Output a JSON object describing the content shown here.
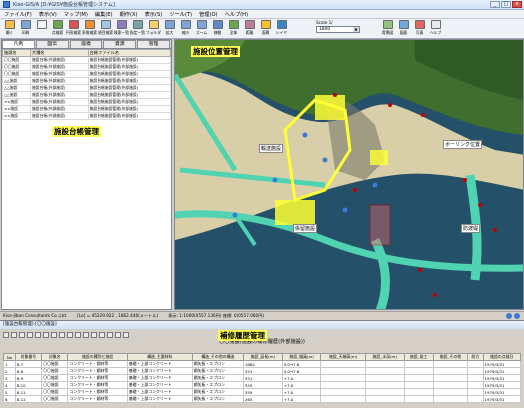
{
  "window": {
    "title": "Kiso-GIS/A [D:¥GIS¥施設台帳管理システム]"
  },
  "menu": [
    "ファイル(F)",
    "表示(V)",
    "マップ(M)",
    "編集(E)",
    "期作(X)",
    "表示(S)",
    "ツール(T)",
    "管理(O)",
    "ヘルプ(H)"
  ],
  "toolbar": [
    {
      "label": "開く",
      "icon": "open-icon",
      "color": "#f2c04a"
    },
    {
      "label": "印刷",
      "icon": "print-icon",
      "color": "#7aa6d9"
    },
    {
      "label": "",
      "icon": "pointer-icon",
      "color": "#f4f4f4"
    },
    {
      "label": "点検索",
      "icon": "point-search-icon",
      "color": "#6aa84f"
    },
    {
      "label": "円形検索",
      "icon": "circle-search-icon",
      "color": "#d9534f"
    },
    {
      "label": "多角検索",
      "icon": "polygon-search-icon",
      "color": "#e69138"
    },
    {
      "label": "項目検索",
      "icon": "item-search-icon",
      "color": "#9fc5e8"
    },
    {
      "label": "検索一覧",
      "icon": "result-list-icon",
      "color": "#8e7cc3"
    },
    {
      "label": "指定一覧",
      "icon": "selected-list-icon",
      "color": "#76a5af"
    },
    {
      "label": "フォルダ",
      "icon": "folder-icon",
      "color": "#f6d06a"
    },
    {
      "label": "拡大",
      "icon": "zoom-in-icon",
      "color": "#7aa6d9"
    },
    {
      "label": "縮小",
      "icon": "zoom-out-icon",
      "color": "#7aa6d9"
    },
    {
      "label": "ズーム",
      "icon": "zoom-icon",
      "color": "#7aa6d9"
    },
    {
      "label": "移動",
      "icon": "pan-icon",
      "color": "#5b8ac6"
    },
    {
      "label": "全体",
      "icon": "full-extent-icon",
      "color": "#6aa84f"
    },
    {
      "label": "距離",
      "icon": "measure-icon",
      "color": "#c27ba0"
    },
    {
      "label": "面積",
      "icon": "area-icon",
      "color": "#f1c232"
    },
    {
      "label": "レイヤ",
      "icon": "layer-icon",
      "color": "#3d85c6"
    }
  ],
  "toolbar_right": [
    {
      "label": "背景図",
      "icon": "background-map-icon",
      "color": "#93c47d"
    },
    {
      "label": "図面",
      "icon": "drawing-icon",
      "color": "#6fa8dc"
    },
    {
      "label": "写真",
      "icon": "photo-icon",
      "color": "#e06666"
    },
    {
      "label": "ヘルプ",
      "icon": "help-icon",
      "color": "#e8e8e8"
    }
  ],
  "scale": {
    "label": "Scale 1/",
    "value": "1800"
  },
  "left_tabs": [
    "凡例",
    "図伝",
    "座標",
    "資源",
    "管理"
  ],
  "left_list": {
    "headers": [
      "施設名",
      "大種名",
      "台帳ファイル名"
    ],
    "rows": [
      [
        "〇〇施設",
        "施設台帳(外部施設)",
        "施設台帳施設管理(外部施設)"
      ],
      [
        "〇〇施設",
        "施設台帳(外部施設)",
        "施設台帳施設管理(外部施設)"
      ],
      [
        "〇〇施設",
        "施設台帳(外部施設)",
        "施設台帳施設管理(外部施設)"
      ],
      [
        "△△施設",
        "施設台帳(外部施設)",
        "施設台帳施設管理(外部施設)"
      ],
      [
        "△△施設",
        "施設台帳(外部施設)",
        "施設台帳施設管理(外部施設)"
      ],
      [
        "△△施設",
        "施設台帳(外部施設)",
        "施設台帳施設管理(外部施設)"
      ],
      [
        "××施設",
        "施設台帳(外部施設)",
        "施設台帳施設管理(外部施設)"
      ],
      [
        "××施設",
        "施設台帳(外部施設)",
        "施設台帳施設管理(外部施設)"
      ],
      [
        "××施設",
        "施設台帳(外部施設)",
        "施設台帳施設管理(外部施設)"
      ]
    ]
  },
  "labels": {
    "ledger": "施設台帳管理",
    "facility_position": "施設位置管理",
    "repair_history": "補修履歴管理"
  },
  "map_labels": {
    "transport": "輸送施設",
    "boring": "ボーリング位置",
    "revetment": "防波堤",
    "anchorage": "係留施設"
  },
  "status": {
    "company": "Kiso-Jiban Consultants Co.,Ltd.",
    "coords": "[Lo] = 45229.922 , 1862.446(メートル)",
    "extent": "表示: 1:1000(0557.136円) 座標: 0(0557.060円)"
  },
  "bottom": {
    "title": "[施設台帳管理]-[〇〇施設]",
    "heading": "〇〇施設(施設の補修履歴(外部施設))"
  },
  "history": {
    "headers": [
      "No",
      "対象番号",
      "対象名",
      "施設の種別と施設",
      "構造_主要材料",
      "構造_その他の構造",
      "施設_延長(m)",
      "施設_幅員(m)",
      "施設_天端高(m)",
      "施設_水深(m)",
      "施設_竣工",
      "施設_その他",
      "耐力",
      "施設の点検日"
    ],
    "rows": [
      [
        "1",
        "8-7",
        "〇〇施設",
        "コンクリート・鋼材等",
        "基礎・上部コンクリート",
        "鋼矢板・エプロン",
        "1862",
        "5.0→7.6",
        "",
        "",
        "",
        "",
        "",
        "1979/3/31"
      ],
      [
        "2",
        "8-8",
        "〇〇施設",
        "コンクリート・鋼材等",
        "基礎・上部コンクリート",
        "鋼矢板・エプロン",
        "351",
        "5.0→7.6",
        "",
        "",
        "",
        "",
        "",
        "1979/3/31"
      ],
      [
        "3",
        "8-9",
        "〇〇施設",
        "コンクリート・鋼材等",
        "基礎・上部コンクリート",
        "鋼矢板・エプロン",
        "351",
        "+7.0",
        "",
        "",
        "",
        "",
        "",
        "1979/3/31"
      ],
      [
        "4",
        "8-10",
        "〇〇施設",
        "コンクリート・鋼材等",
        "基礎・上部コンクリート",
        "鋼矢板・エプロン",
        "355",
        "+7.0",
        "",
        "",
        "",
        "",
        "",
        "1979/3/31"
      ],
      [
        "5",
        "8-11",
        "〇〇施設",
        "コンクリート・鋼材等",
        "基礎・上部コンクリート",
        "鋼矢板・エプロン",
        "359",
        "+7.0",
        "",
        "",
        "",
        "",
        "",
        "1979/3/31"
      ],
      [
        "6",
        "8-12",
        "〇〇施設",
        "コンクリート・鋼材等",
        "基礎・上部コンクリート",
        "鋼矢板・エプロン",
        "265",
        "+7.0",
        "",
        "",
        "",
        "",
        "",
        "1979/3/31"
      ]
    ]
  },
  "colors": {
    "highlight": "#ffff55",
    "water": "#1f4f6b",
    "sand": "#d8cfa8",
    "vegetation": "#3f6e2f",
    "structure_teal": "#4fd3b0",
    "structure_yellow": "#ffff33"
  }
}
